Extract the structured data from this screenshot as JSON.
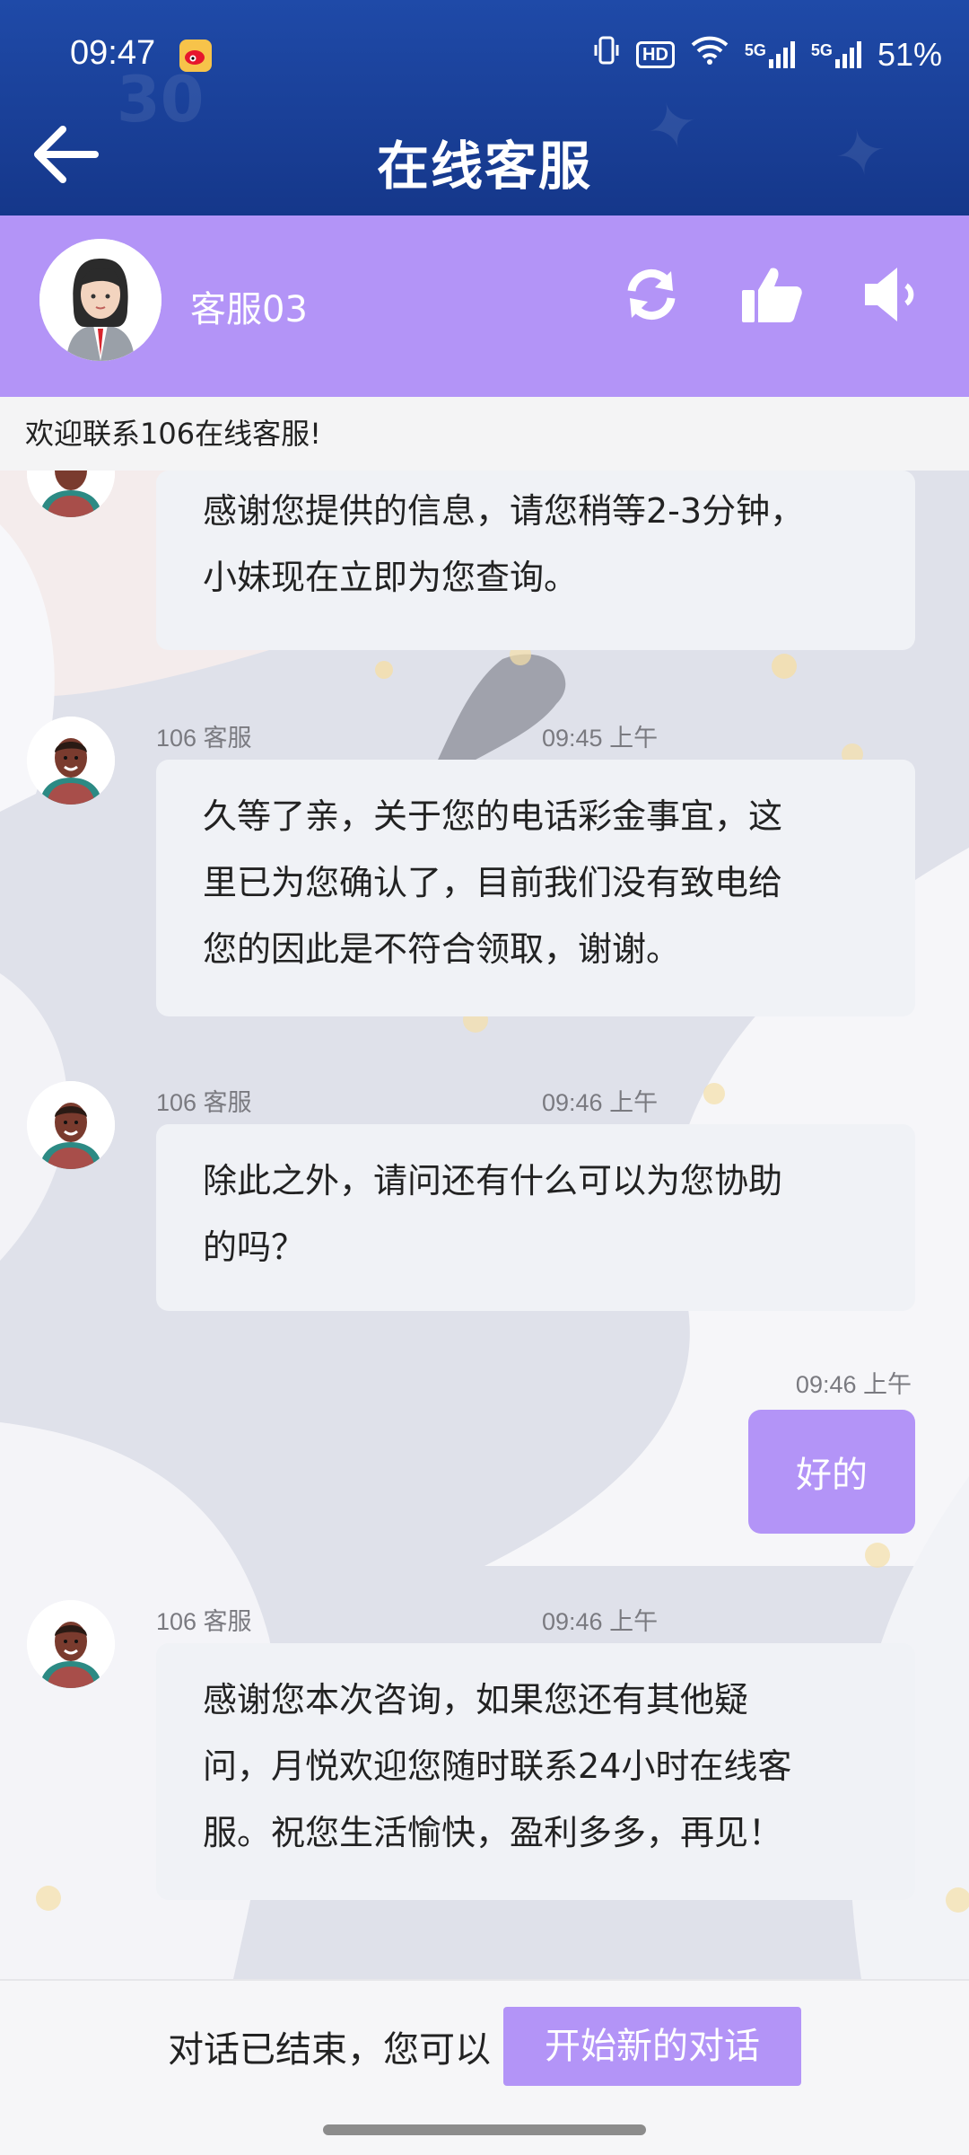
{
  "status_bar": {
    "time": "09:47",
    "hd_label": "HD",
    "network1": "5G",
    "network2": "5G",
    "battery": "51%"
  },
  "header": {
    "title": "在线客服"
  },
  "agent": {
    "name": "客服03"
  },
  "welcome": "欢迎联系106在线客服!",
  "messages": [
    {
      "sender": "",
      "time": "",
      "lines": [
        "感谢您提供的信息，请您稍等2-3分钟，",
        "小妹现在立即为您查询。"
      ]
    },
    {
      "sender": "106 客服",
      "time": "09:45 上午",
      "lines": [
        "久等了亲，关于您的电话彩金事宜，这",
        "里已为您确认了，目前我们没有致电给",
        "您的因此是不符合领取，谢谢。"
      ]
    },
    {
      "sender": "106 客服",
      "time": "09:46 上午",
      "lines": [
        "除此之外，请问还有什么可以为您协助",
        "的吗？"
      ]
    },
    {
      "sender": "106 客服",
      "time": "09:46 上午",
      "lines": [
        "感谢您本次咨询，如果您还有其他疑",
        "问，月悦欢迎您随时联系24小时在线客",
        "服。祝您生活愉快，盈利多多，再见！"
      ]
    }
  ],
  "my_message": {
    "time": "09:46 上午",
    "text": "好的"
  },
  "footer": {
    "text": "对话已结束，您可以",
    "button": "开始新的对话"
  },
  "colors": {
    "header_blue": "#1f4aa8",
    "accent_purple": "#b394f7"
  }
}
